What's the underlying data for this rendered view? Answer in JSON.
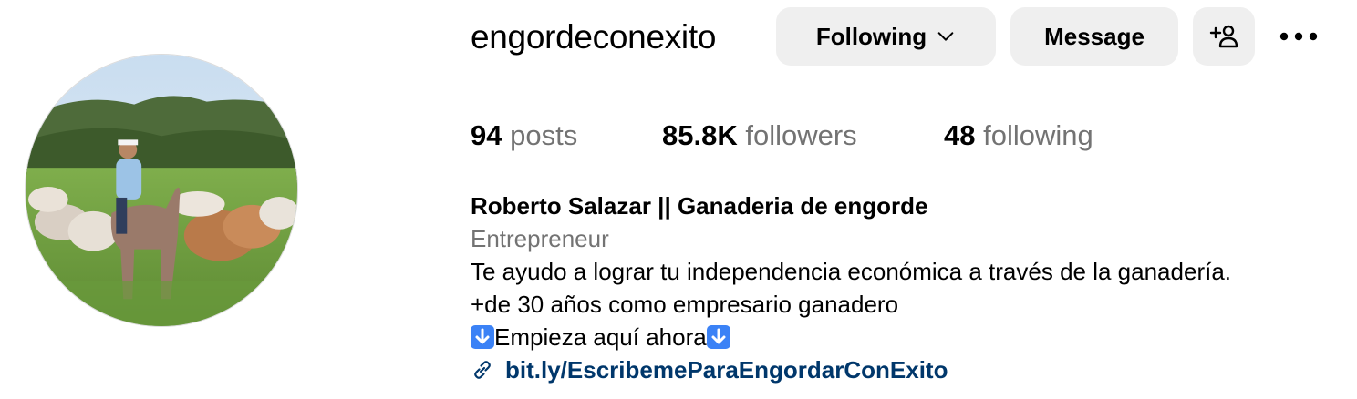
{
  "profile": {
    "username": "engordeconexito",
    "buttons": {
      "following_label": "Following",
      "message_label": "Message",
      "add_user_icon": "add-person-icon",
      "more_icon": "more-options-icon"
    },
    "stats": {
      "posts_count": "94",
      "posts_label": "posts",
      "followers_count": "85.8K",
      "followers_label": "followers",
      "following_count": "48",
      "following_label": "following"
    },
    "bio": {
      "full_name": "Roberto Salazar || Ganaderia de engorde",
      "category": "Entrepreneur",
      "line1": "Te ayudo a lograr tu independencia económica a través de la ganadería.",
      "line2": "+de 30 años como empresario ganadero",
      "line3": "Empieza aquí ahora",
      "link": "bit.ly/EscribemeParaEngordarConExito"
    }
  },
  "colors": {
    "button_bg": "#efefef",
    "secondary_text": "#737373",
    "link_text": "#00376b",
    "emoji_blue": "#3b82f6"
  }
}
